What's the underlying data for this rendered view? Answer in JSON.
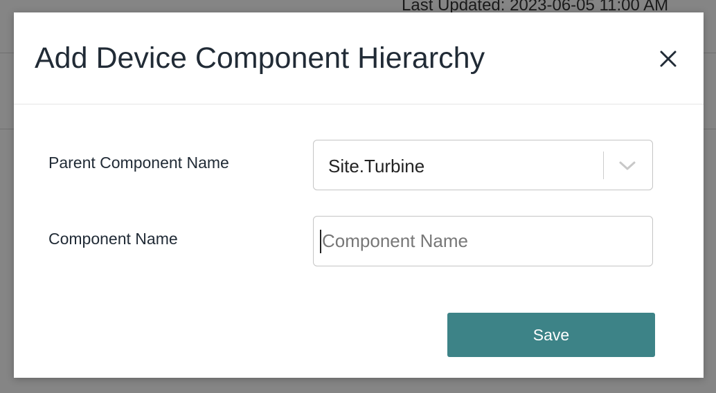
{
  "background": {
    "last_updated_text": "Last Updated: 2023-06-05 11:00 AM"
  },
  "modal": {
    "title": "Add Device Component Hierarchy",
    "close_icon": "close-icon",
    "parent_field": {
      "label": "Parent Component Name",
      "selected_value": "Site.Turbine",
      "icon": "chevron-down-icon"
    },
    "component_field": {
      "label": "Component Name",
      "value": "",
      "placeholder": "Component Name"
    },
    "save_label": "Save"
  },
  "colors": {
    "accent": "#3d8387",
    "title_text": "#212b36",
    "overlay": "#858585"
  }
}
